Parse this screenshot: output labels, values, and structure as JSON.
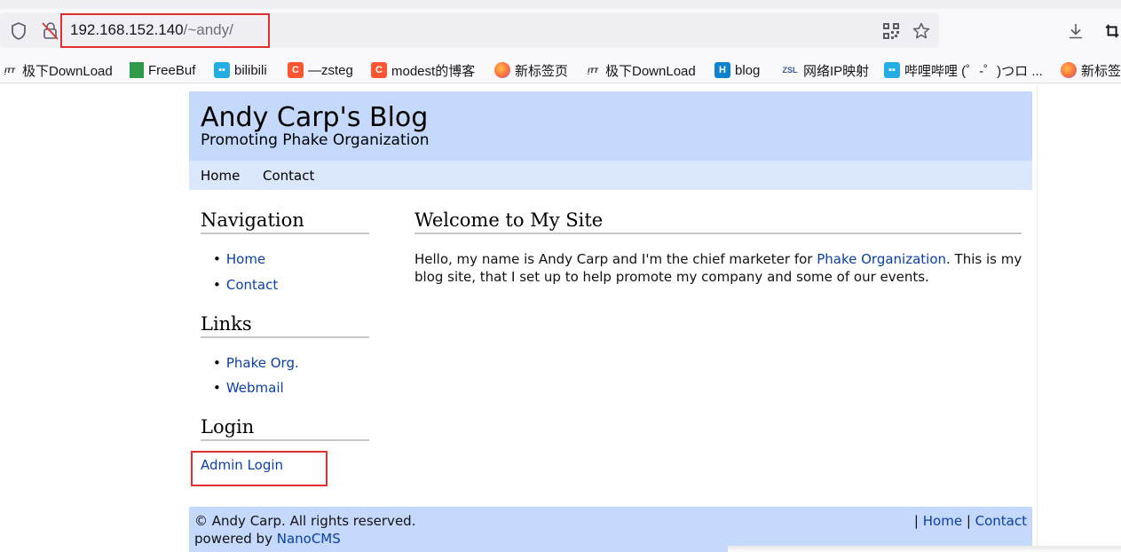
{
  "browser": {
    "url_host": "192.168.152.140",
    "url_path": "/~andy/",
    "bookmarks": [
      {
        "label": "极下DownLoad",
        "icon": "download-site-icon",
        "color": "#333333"
      },
      {
        "label": "FreeBuf",
        "icon": "freebuf-icon",
        "color": "#2e9a4a"
      },
      {
        "label": "bilibili",
        "icon": "bilibili-icon",
        "color": "#23ade5"
      },
      {
        "label": "—zsteg",
        "icon": "csdn-icon",
        "color": "#fc5531"
      },
      {
        "label": "modest的博客",
        "icon": "csdn-icon",
        "color": "#fc5531"
      },
      {
        "label": "新标签页",
        "icon": "firefox-icon",
        "color": "#ff7139"
      },
      {
        "label": "极下DownLoad",
        "icon": "download-site-icon",
        "color": "#333333"
      },
      {
        "label": "blog",
        "icon": "hexo-icon",
        "color": "#0e83cd"
      },
      {
        "label": "网络IP映射",
        "icon": "zsl-icon",
        "color": "#3a5a9a"
      },
      {
        "label": "哔哩哔哩 (゜-゜)つロ ...",
        "icon": "bilibili-icon",
        "color": "#23ade5"
      },
      {
        "label": "新标签",
        "icon": "firefox-icon",
        "color": "#ff7139"
      }
    ]
  },
  "site": {
    "title": "Andy Carp's Blog",
    "tagline": "Promoting Phake Organization",
    "topnav": [
      "Home",
      "Contact"
    ]
  },
  "sidebar": {
    "navigation_heading": "Navigation",
    "navigation_items": [
      "Home",
      "Contact"
    ],
    "links_heading": "Links",
    "links_items": [
      "Phake Org.",
      "Webmail"
    ],
    "login_heading": "Login",
    "admin_login": "Admin Login"
  },
  "main": {
    "heading": "Welcome to My Site",
    "text_before": "Hello, my name is Andy Carp and I'm the chief marketer for ",
    "link_text": "Phake Organization",
    "text_after": ". This is my blog site, that I set up to help promote my company and some of our events."
  },
  "footer": {
    "copyright": "© Andy Carp. All rights reserved.",
    "powered_prefix": "powered by ",
    "powered_link": "NanoCMS",
    "sep1": "| ",
    "home_link": "Home",
    "sep2": " | ",
    "contact_link": "Contact"
  },
  "colors": {
    "header_bg": "#c4d9fb",
    "nav_bg": "#dbe7fd",
    "link": "#0b3ea8",
    "annotation_red": "#e0302f"
  }
}
